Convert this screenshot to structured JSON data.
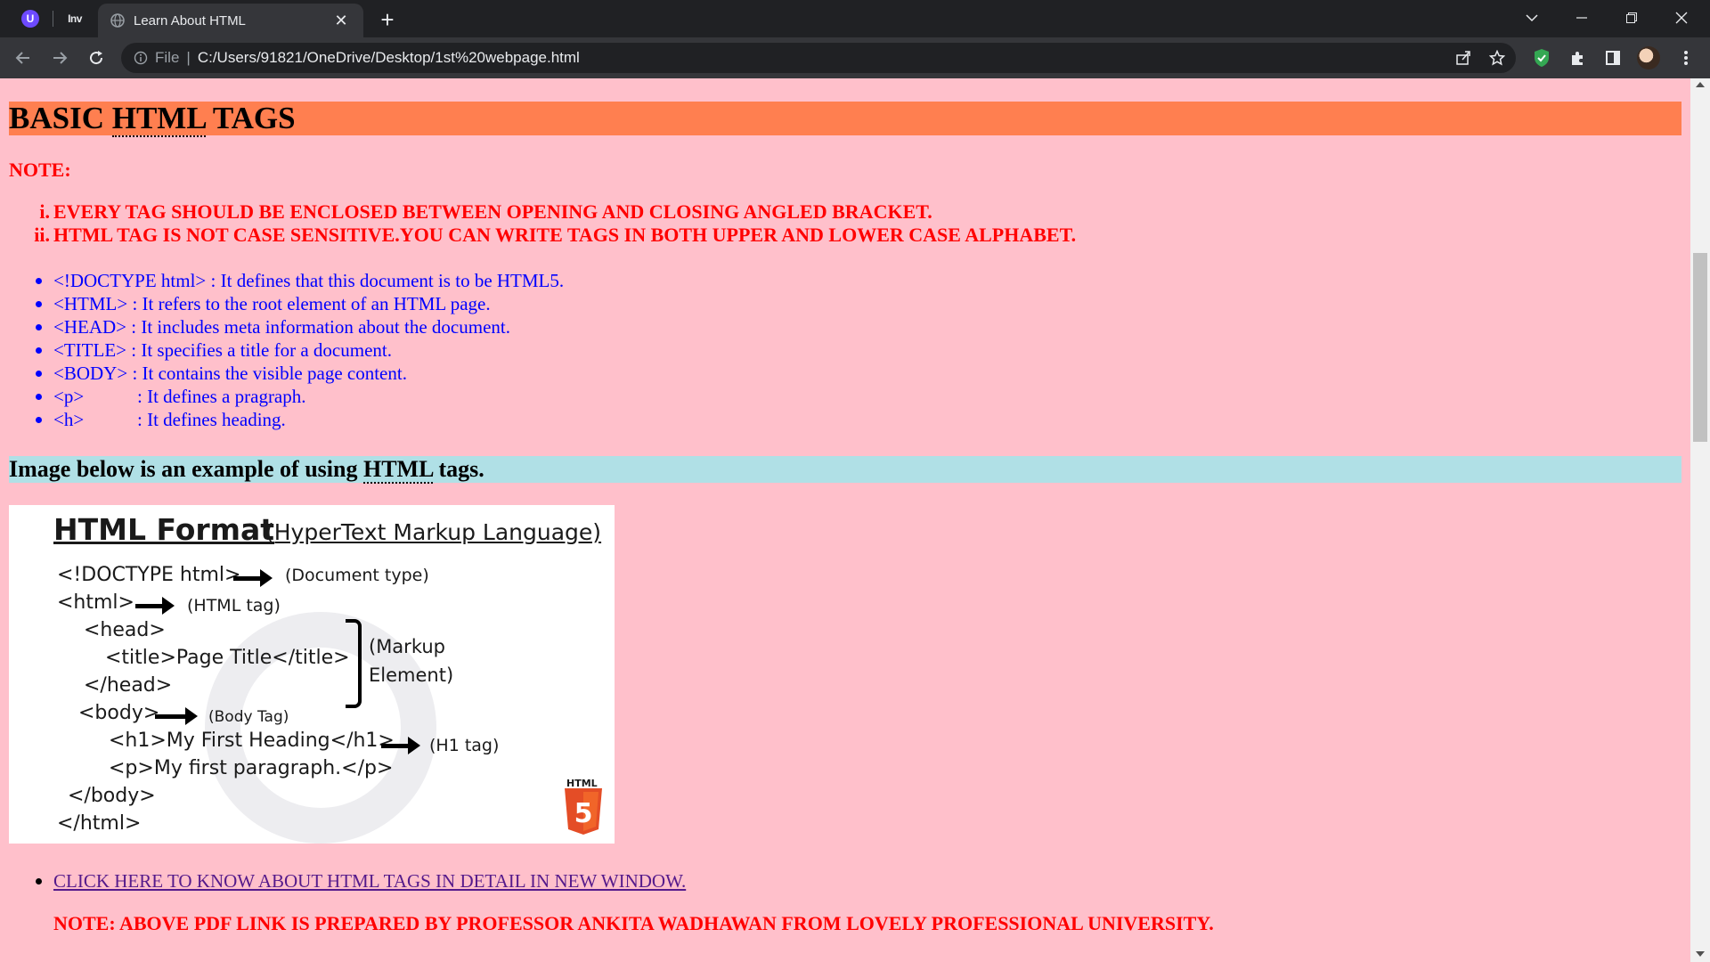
{
  "browser": {
    "pinned_tabs": [
      {
        "name": "proton-tab",
        "glyph": "U"
      },
      {
        "name": "inv-tab",
        "glyph": "Inv"
      }
    ],
    "active_tab": {
      "title": "Learn About HTML"
    },
    "address": {
      "scheme": "File",
      "url": "C:/Users/91821/OneDrive/Desktop/1st%20webpage.html"
    }
  },
  "page": {
    "heading": {
      "prefix": "BASIC ",
      "abbr": "HTML",
      "suffix": " TAGS"
    },
    "note_label": "NOTE:",
    "notes": [
      {
        "num": "i.",
        "text": "EVERY TAG SHOULD BE ENCLOSED BETWEEN OPENING AND CLOSING ANGLED BRACKET."
      },
      {
        "num": "ii.",
        "text": "HTML TAG IS NOT CASE SENSITIVE.YOU CAN WRITE TAGS IN BOTH UPPER AND LOWER CASE ALPHABET."
      }
    ],
    "tags": [
      {
        "tag": "<!DOCTYPE html>",
        "desc": " : It defines that this document is to be HTML5."
      },
      {
        "tag": "<HTML>",
        "desc": " : It refers to the root element of an HTML page."
      },
      {
        "tag": "<HEAD>",
        "desc": " : It includes meta information about the document."
      },
      {
        "tag": "<TITLE>",
        "desc": " : It specifies a title for a document."
      },
      {
        "tag": "<BODY>",
        "desc": " : It contains the visible page content."
      },
      {
        "tag": "<p>",
        "desc": ": It defines a pragraph."
      },
      {
        "tag": "<h>",
        "desc": ": It defines heading."
      }
    ],
    "heading2": {
      "prefix": "Image below is an example of using ",
      "abbr": "HTML",
      "suffix": " tags."
    },
    "image": {
      "title": "HTML Format",
      "subtitle": "(HyperText Markup Language)",
      "lines": [
        "<!DOCTYPE html>",
        "<html>",
        "<head>",
        "<title>Page Title</title>",
        "</head>",
        "<body>",
        "<h1>My First Heading</h1>",
        "<p>My first paragraph.</p>",
        "</body>",
        "</html>"
      ],
      "labels": {
        "doctype": "(Document type)",
        "html": "(HTML tag)",
        "markup1": "(Markup",
        "markup2": "Element)",
        "body": "(Body Tag)",
        "h1": "(H1 tag)"
      },
      "badge_label": "HTML",
      "badge_number": "5"
    },
    "link_text": "CLICK HERE TO KNOW ABOUT HTML TAGS IN DETAIL IN NEW WINDOW.",
    "final_note": "NOTE: ABOVE PDF LINK IS PREPARED BY PROFESSOR ANKITA WADHAWAN FROM LOVELY PROFESSIONAL UNIVERSITY."
  },
  "colors": {
    "page_bg": "#ffc0cb",
    "heading_bg": "#ff7f50",
    "heading2_bg": "#b0e0e6",
    "note_text": "#ff0000",
    "list_text": "#0000ff",
    "link": "#551a8b"
  }
}
